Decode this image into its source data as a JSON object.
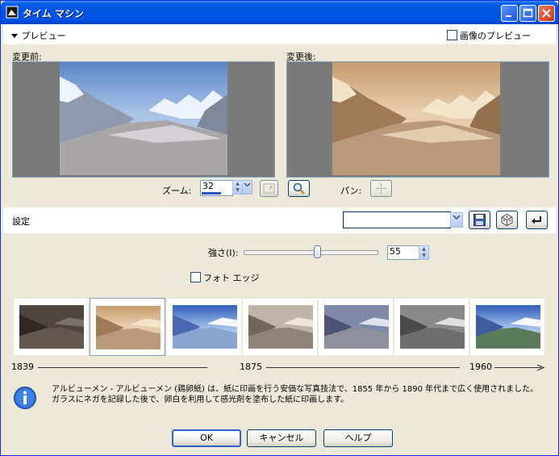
{
  "window": {
    "title": "タイム マシン"
  },
  "preview": {
    "toggle_label": "プレビュー",
    "image_preview_label": "画像のプレビュー",
    "before_label": "変更前:",
    "after_label": "変更後:"
  },
  "zoom": {
    "label": "ズーム:",
    "value": "32"
  },
  "pan": {
    "label": "パン:"
  },
  "settings": {
    "label": "設定",
    "preset_value": ""
  },
  "strength": {
    "label": "強さ(I):",
    "value": "55",
    "level": 0.55
  },
  "photo_edge": {
    "label": "フォト エッジ",
    "checked": false
  },
  "styles": {
    "selected_index": 1,
    "items": [
      "style-1839-a",
      "style-1839-b",
      "style-1875-a",
      "style-1875-b",
      "style-1875-c",
      "style-1960-a",
      "style-1960-b"
    ]
  },
  "timeline": {
    "start": "1839",
    "middle": "1875",
    "end": "1960"
  },
  "info": {
    "text_line1": "アルビューメン - アルビューメン (鶏卵紙) は、紙に印画を行う安価な写真技法で、1855 年から 1890 年代まで広く使用されました。",
    "text_line2": "ガラスにネガを記録した後で、卵白を利用して感光剤を塗布した紙に印画します。"
  },
  "buttons": {
    "ok": "OK",
    "cancel": "キャンセル",
    "help": "ヘルプ"
  },
  "colors": {
    "title_bar": "#0054e3",
    "dialog_bg": "#ece9d8",
    "sepia": "#b08860"
  }
}
